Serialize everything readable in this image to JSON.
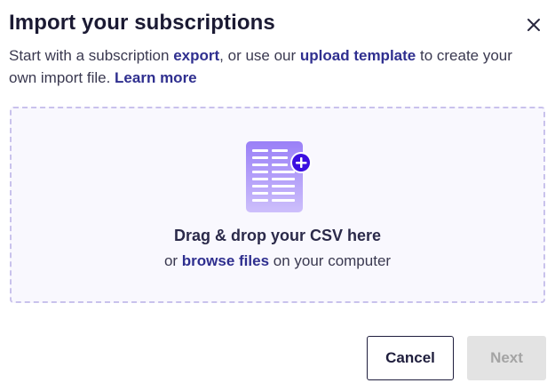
{
  "dialog": {
    "title": "Import your subscriptions",
    "close_icon": "close-icon"
  },
  "description": {
    "part1": "Start with a subscription ",
    "export_link": "export",
    "part2": ", or use our ",
    "template_link": "upload template",
    "part3": " to create your own import file. ",
    "learn_more_link": "Learn more"
  },
  "dropzone": {
    "icon": "csv-file-add-icon",
    "title": "Drag & drop your CSV here",
    "sub_prefix": "or ",
    "browse_link": "browse files",
    "sub_suffix": " on your computer"
  },
  "footer": {
    "cancel_label": "Cancel",
    "next_label": "Next",
    "next_disabled": true
  },
  "colors": {
    "accent": "#2f2f8f",
    "icon_purple": "#8d70f5",
    "plus_badge": "#3b0fe0",
    "dropzone_border": "#c9c2ec"
  }
}
